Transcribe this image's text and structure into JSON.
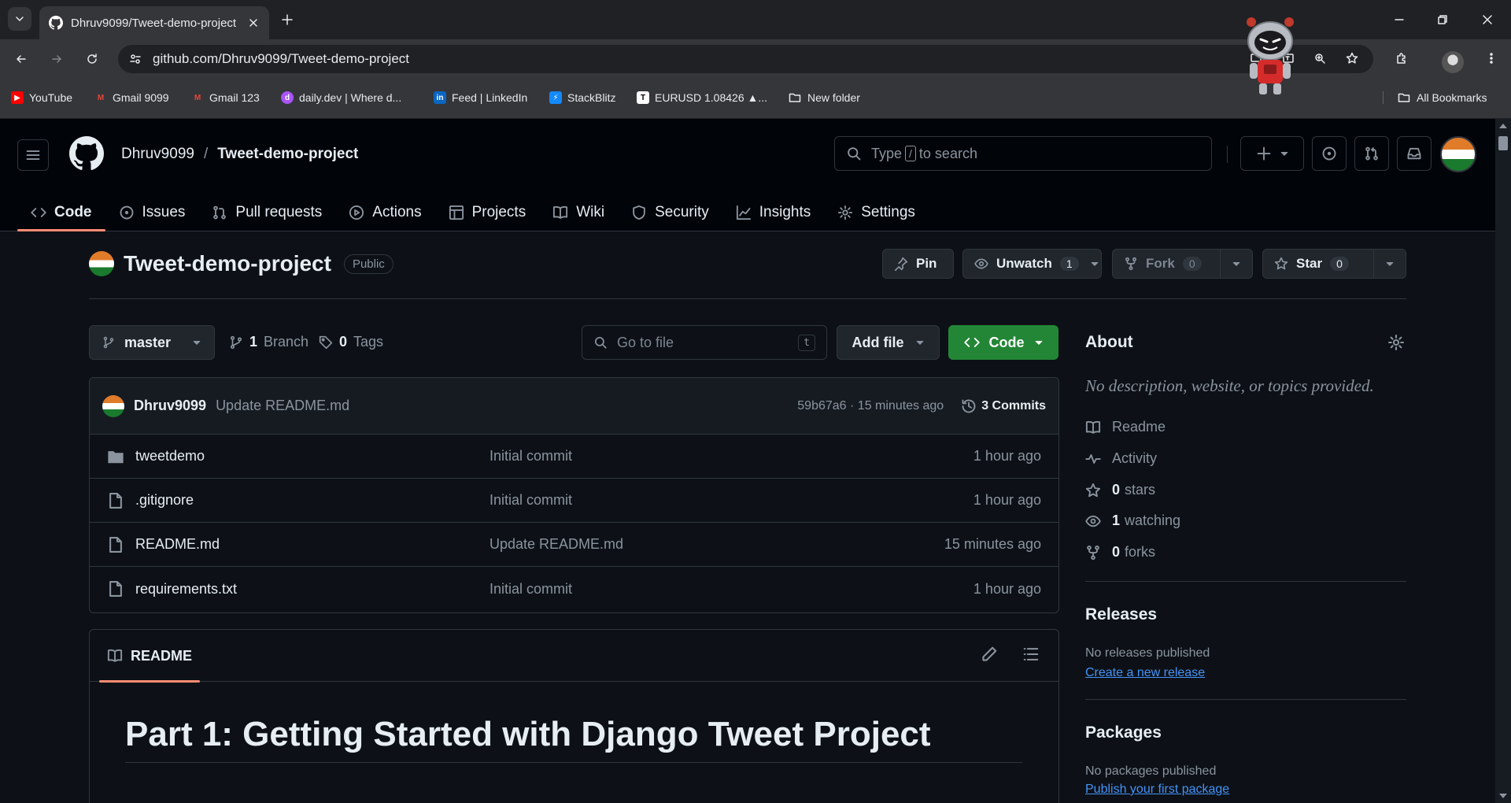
{
  "browser": {
    "tab_title": "Dhruv9099/Tweet-demo-project",
    "url": "github.com/Dhruv9099/Tweet-demo-project",
    "bookmarks": [
      {
        "label": "YouTube",
        "icon": "youtube-icon",
        "color": "#ff0000"
      },
      {
        "label": "Gmail 9099",
        "icon": "gmail-icon",
        "color": "#ea4335"
      },
      {
        "label": "Gmail 123",
        "icon": "gmail-icon",
        "color": "#ea4335"
      },
      {
        "label": "daily.dev | Where d...",
        "icon": "dailydev-icon",
        "color": "#a855f7"
      },
      {
        "label": "Feed | LinkedIn",
        "icon": "linkedin-icon",
        "color": "#0a66c2"
      },
      {
        "label": "StackBlitz",
        "icon": "stackblitz-icon",
        "color": "#1389fd"
      },
      {
        "label": "EURUSD 1.08426 ▲...",
        "icon": "tradingview-icon",
        "color": "#ffffff"
      },
      {
        "label": "New folder",
        "icon": "folder-icon",
        "color": "#e8eaed"
      }
    ],
    "all_bookmarks": "All Bookmarks"
  },
  "header": {
    "owner": "Dhruv9099",
    "separator": "/",
    "repo": "Tweet-demo-project",
    "search_prefix": "Type",
    "search_key": "/",
    "search_suffix": "to search"
  },
  "repo_nav": [
    {
      "label": "Code",
      "icon": "code-icon",
      "active": true
    },
    {
      "label": "Issues",
      "icon": "issue-icon"
    },
    {
      "label": "Pull requests",
      "icon": "pull-request-icon"
    },
    {
      "label": "Actions",
      "icon": "play-icon"
    },
    {
      "label": "Projects",
      "icon": "table-icon"
    },
    {
      "label": "Wiki",
      "icon": "book-icon"
    },
    {
      "label": "Security",
      "icon": "shield-icon"
    },
    {
      "label": "Insights",
      "icon": "graph-icon"
    },
    {
      "label": "Settings",
      "icon": "gear-icon"
    }
  ],
  "repo": {
    "name": "Tweet-demo-project",
    "visibility": "Public",
    "pin_label": "Pin",
    "unwatch_label": "Unwatch",
    "watch_count": "1",
    "fork_label": "Fork",
    "fork_count": "0",
    "star_label": "Star",
    "star_count": "0"
  },
  "browser_bar": {
    "branch": "master",
    "branch_count": "1",
    "branch_label": "Branch",
    "tag_count": "0",
    "tag_label": "Tags",
    "goto_placeholder": "Go to file",
    "goto_key": "t",
    "add_file": "Add file",
    "code": "Code"
  },
  "last_commit": {
    "author": "Dhruv9099",
    "message": "Update README.md",
    "sha_time": "59b67a6 · 15 minutes ago",
    "commits": "3 Commits"
  },
  "files": [
    {
      "name": "tweetdemo",
      "type": "folder",
      "message": "Initial commit",
      "time": "1 hour ago"
    },
    {
      "name": ".gitignore",
      "type": "file",
      "message": "Initial commit",
      "time": "1 hour ago"
    },
    {
      "name": "README.md",
      "type": "file",
      "message": "Update README.md",
      "time": "15 minutes ago"
    },
    {
      "name": "requirements.txt",
      "type": "file",
      "message": "Initial commit",
      "time": "1 hour ago"
    }
  ],
  "readme": {
    "tab": "README",
    "heading": "Part 1: Getting Started with Django Tweet Project"
  },
  "about": {
    "title": "About",
    "description": "No description, website, or topics provided.",
    "readme": "Readme",
    "activity": "Activity",
    "stars_count": "0",
    "stars_label": "stars",
    "watching_count": "1",
    "watching_label": "watching",
    "forks_count": "0",
    "forks_label": "forks"
  },
  "releases": {
    "title": "Releases",
    "note": "No releases published",
    "link": "Create a new release"
  },
  "packages": {
    "title": "Packages",
    "note": "No packages published",
    "link": "Publish your first package"
  },
  "colors": {
    "accent_underline": "#fd8c73",
    "code_button": "#238636",
    "link": "#4493f8"
  }
}
